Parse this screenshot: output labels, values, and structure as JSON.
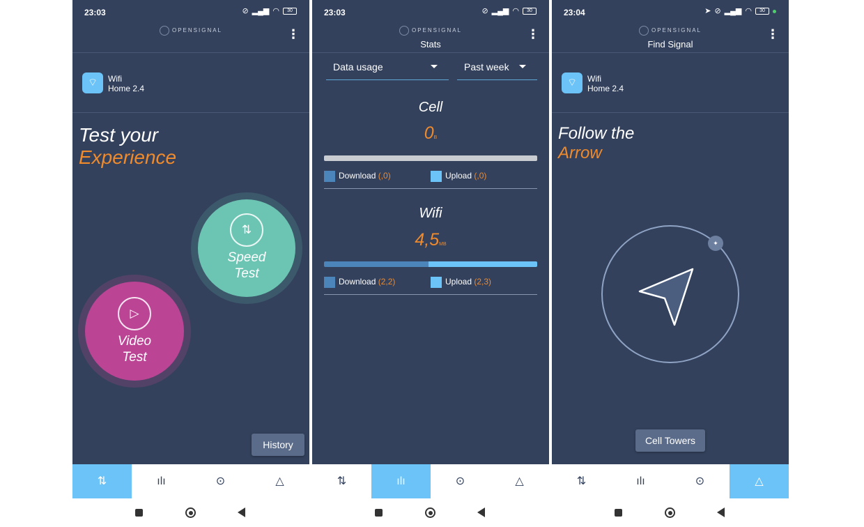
{
  "colors": {
    "background": "#33415c",
    "accent_orange": "#ef8a2d",
    "active_tab": "#6cc3f7",
    "speed_test": "#6cc4b2",
    "video_test": "#bc4495",
    "download": "#4b85ba",
    "upload": "#6cc3f7"
  },
  "app": {
    "logo_text": "OPENSIGNAL"
  },
  "screen1": {
    "status": {
      "time": "23:03",
      "battery": "30"
    },
    "network": {
      "type": "Wifi",
      "name": "Home 2.4"
    },
    "headline": {
      "line1": "Test your",
      "line2": "Experience"
    },
    "speed_test": {
      "line1": "Speed",
      "line2": "Test",
      "icon": "speed-arrows-icon"
    },
    "video_test": {
      "line1": "Video",
      "line2": "Test",
      "icon": "play-icon"
    },
    "history_label": "History",
    "active_tab": "speed-test"
  },
  "screen2": {
    "status": {
      "time": "23:03",
      "battery": "30"
    },
    "title": "Stats",
    "metric_select": "Data usage",
    "period_select": "Past week",
    "cell": {
      "title": "Cell",
      "value": "0",
      "unit": "B",
      "download_label": "Download",
      "download_value": "(,0)",
      "upload_label": "Upload",
      "upload_value": "(,0)",
      "download_fraction": 0
    },
    "wifi": {
      "title": "Wifi",
      "value": "4,5",
      "unit": "MB",
      "download_label": "Download",
      "download_value": "(2,2)",
      "upload_label": "Upload",
      "upload_value": "(2,3)",
      "download_fraction": 0.49
    },
    "active_tab": "stats"
  },
  "screen3": {
    "status": {
      "time": "23:04",
      "battery": "30"
    },
    "title": "Find Signal",
    "network": {
      "type": "Wifi",
      "name": "Home 2.4"
    },
    "headline": {
      "line1": "Follow the",
      "line2": "Arrow"
    },
    "cell_towers_label": "Cell Towers",
    "active_tab": "find-signal"
  },
  "tabs": [
    {
      "id": "speed-test",
      "icon": "arrows-updown-icon",
      "glyph": "⇅"
    },
    {
      "id": "stats",
      "icon": "bar-chart-icon",
      "glyph": "ılı"
    },
    {
      "id": "map",
      "icon": "map-pin-icon",
      "glyph": "⊙"
    },
    {
      "id": "find-signal",
      "icon": "navigation-triangle-icon",
      "glyph": "△"
    }
  ]
}
